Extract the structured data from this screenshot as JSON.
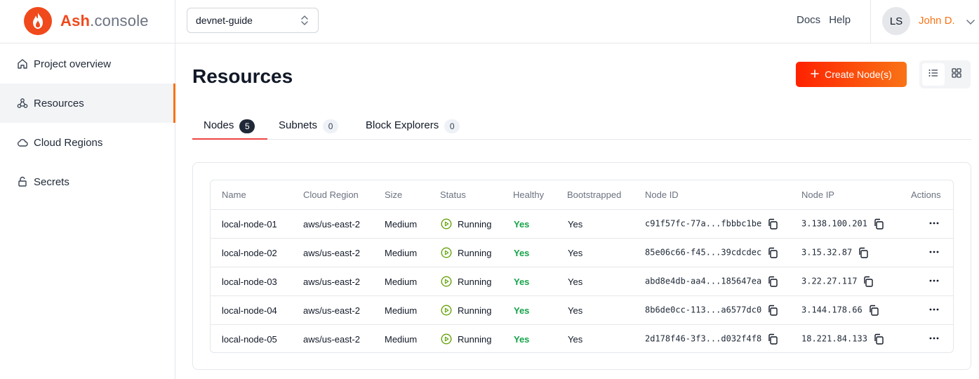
{
  "brand": {
    "name_main": "Ash",
    "name_suffix": ".console",
    "color": "#f0491b"
  },
  "project_select": {
    "value": "devnet-guide"
  },
  "top_links": {
    "docs": "Docs",
    "help": "Help"
  },
  "user": {
    "initials": "LS",
    "name": "John D."
  },
  "sidebar": {
    "items": [
      {
        "label": "Project overview",
        "icon": "home-icon",
        "active": false
      },
      {
        "label": "Resources",
        "icon": "webhook-icon",
        "active": true
      },
      {
        "label": "Cloud Regions",
        "icon": "cloud-icon",
        "active": false
      },
      {
        "label": "Secrets",
        "icon": "lock-icon",
        "active": false
      }
    ]
  },
  "page": {
    "title": "Resources",
    "create_button": "Create Node(s)",
    "view_mode": "list"
  },
  "tabs": [
    {
      "label": "Nodes",
      "count": "5",
      "active": true
    },
    {
      "label": "Subnets",
      "count": "0",
      "active": false
    },
    {
      "label": "Block Explorers",
      "count": "0",
      "active": false
    }
  ],
  "table": {
    "headers": [
      "Name",
      "Cloud Region",
      "Size",
      "Status",
      "Healthy",
      "Bootstrapped",
      "Node ID",
      "Node IP",
      "Actions"
    ],
    "rows": [
      {
        "name": "local-node-01",
        "region": "aws/us-east-2",
        "size": "Medium",
        "status": "Running",
        "healthy": "Yes",
        "bootstrapped": "Yes",
        "node_id": "c91f57fc-77a...fbbbc1be",
        "node_ip": "3.138.100.201"
      },
      {
        "name": "local-node-02",
        "region": "aws/us-east-2",
        "size": "Medium",
        "status": "Running",
        "healthy": "Yes",
        "bootstrapped": "Yes",
        "node_id": "85e06c66-f45...39cdcdec",
        "node_ip": "3.15.32.87"
      },
      {
        "name": "local-node-03",
        "region": "aws/us-east-2",
        "size": "Medium",
        "status": "Running",
        "healthy": "Yes",
        "bootstrapped": "Yes",
        "node_id": "abd8e4db-aa4...185647ea",
        "node_ip": "3.22.27.117"
      },
      {
        "name": "local-node-04",
        "region": "aws/us-east-2",
        "size": "Medium",
        "status": "Running",
        "healthy": "Yes",
        "bootstrapped": "Yes",
        "node_id": "8b6de0cc-113...a6577dc0",
        "node_ip": "3.144.178.66"
      },
      {
        "name": "local-node-05",
        "region": "aws/us-east-2",
        "size": "Medium",
        "status": "Running",
        "healthy": "Yes",
        "bootstrapped": "Yes",
        "node_id": "2d178f46-3f3...d032f4f8",
        "node_ip": "18.221.84.133"
      }
    ]
  },
  "colors": {
    "accent": "#f97316",
    "primary": "#ff2200",
    "healthy": "#16a34a",
    "running": "#65a30d"
  }
}
